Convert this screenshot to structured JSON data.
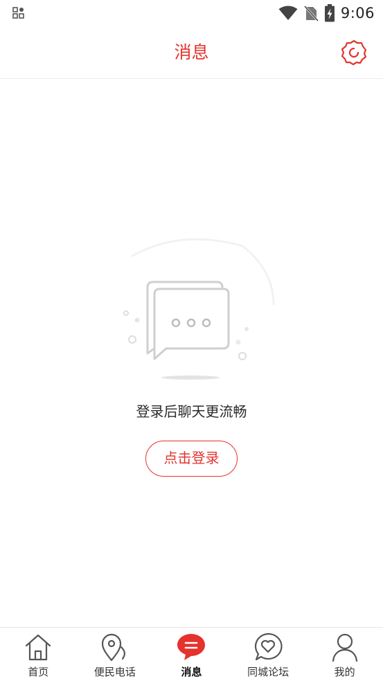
{
  "status_bar": {
    "time": "9:06",
    "icons": [
      "app-grid-icon",
      "wifi-icon",
      "no-sim-icon",
      "battery-charging-icon"
    ]
  },
  "header": {
    "title": "消息",
    "settings_icon": "settings-icon"
  },
  "empty_state": {
    "icon": "chat-bubbles-icon",
    "message": "登录后聊天更流畅",
    "login_button": "点击登录"
  },
  "tabbar": {
    "items": [
      {
        "label": "首页",
        "icon": "home-icon"
      },
      {
        "label": "便民电话",
        "icon": "location-phone-icon"
      },
      {
        "label": "消息",
        "icon": "message-icon",
        "active": true
      },
      {
        "label": "同城论坛",
        "icon": "heart-chat-icon"
      },
      {
        "label": "我的",
        "icon": "person-icon"
      }
    ]
  },
  "colors": {
    "accent": "#e5322d",
    "text": "#2a2a2a",
    "divider": "#ececec"
  }
}
